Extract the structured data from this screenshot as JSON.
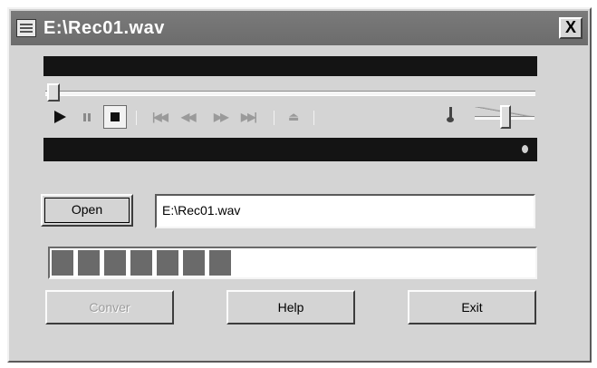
{
  "window": {
    "title": "E:\\Rec01.wav",
    "close_label": "X"
  },
  "player": {
    "icons": {
      "play": "play-icon",
      "pause": "pause-icon",
      "stop": "stop-icon",
      "prev_mark": "previous-mark-icon",
      "rewind": "rewind-icon",
      "fast_forward": "fast-forward-icon",
      "next_mark": "next-mark-icon",
      "eject": "eject-icon",
      "volume": "volume-icon"
    },
    "position": 0.0,
    "volume": 0.45
  },
  "file": {
    "open_label": "Open",
    "path": "E:\\Rec01.wav"
  },
  "progress": {
    "segments_filled": 7,
    "segments_total": 21
  },
  "buttons": {
    "convert_label": "Conver",
    "help_label": "Help",
    "exit_label": "Exit"
  },
  "colors": {
    "title_bar": "#6c6c6c",
    "display": "#141414",
    "progress_segment": "#6a6a6a",
    "window": "#d4d4d4"
  }
}
